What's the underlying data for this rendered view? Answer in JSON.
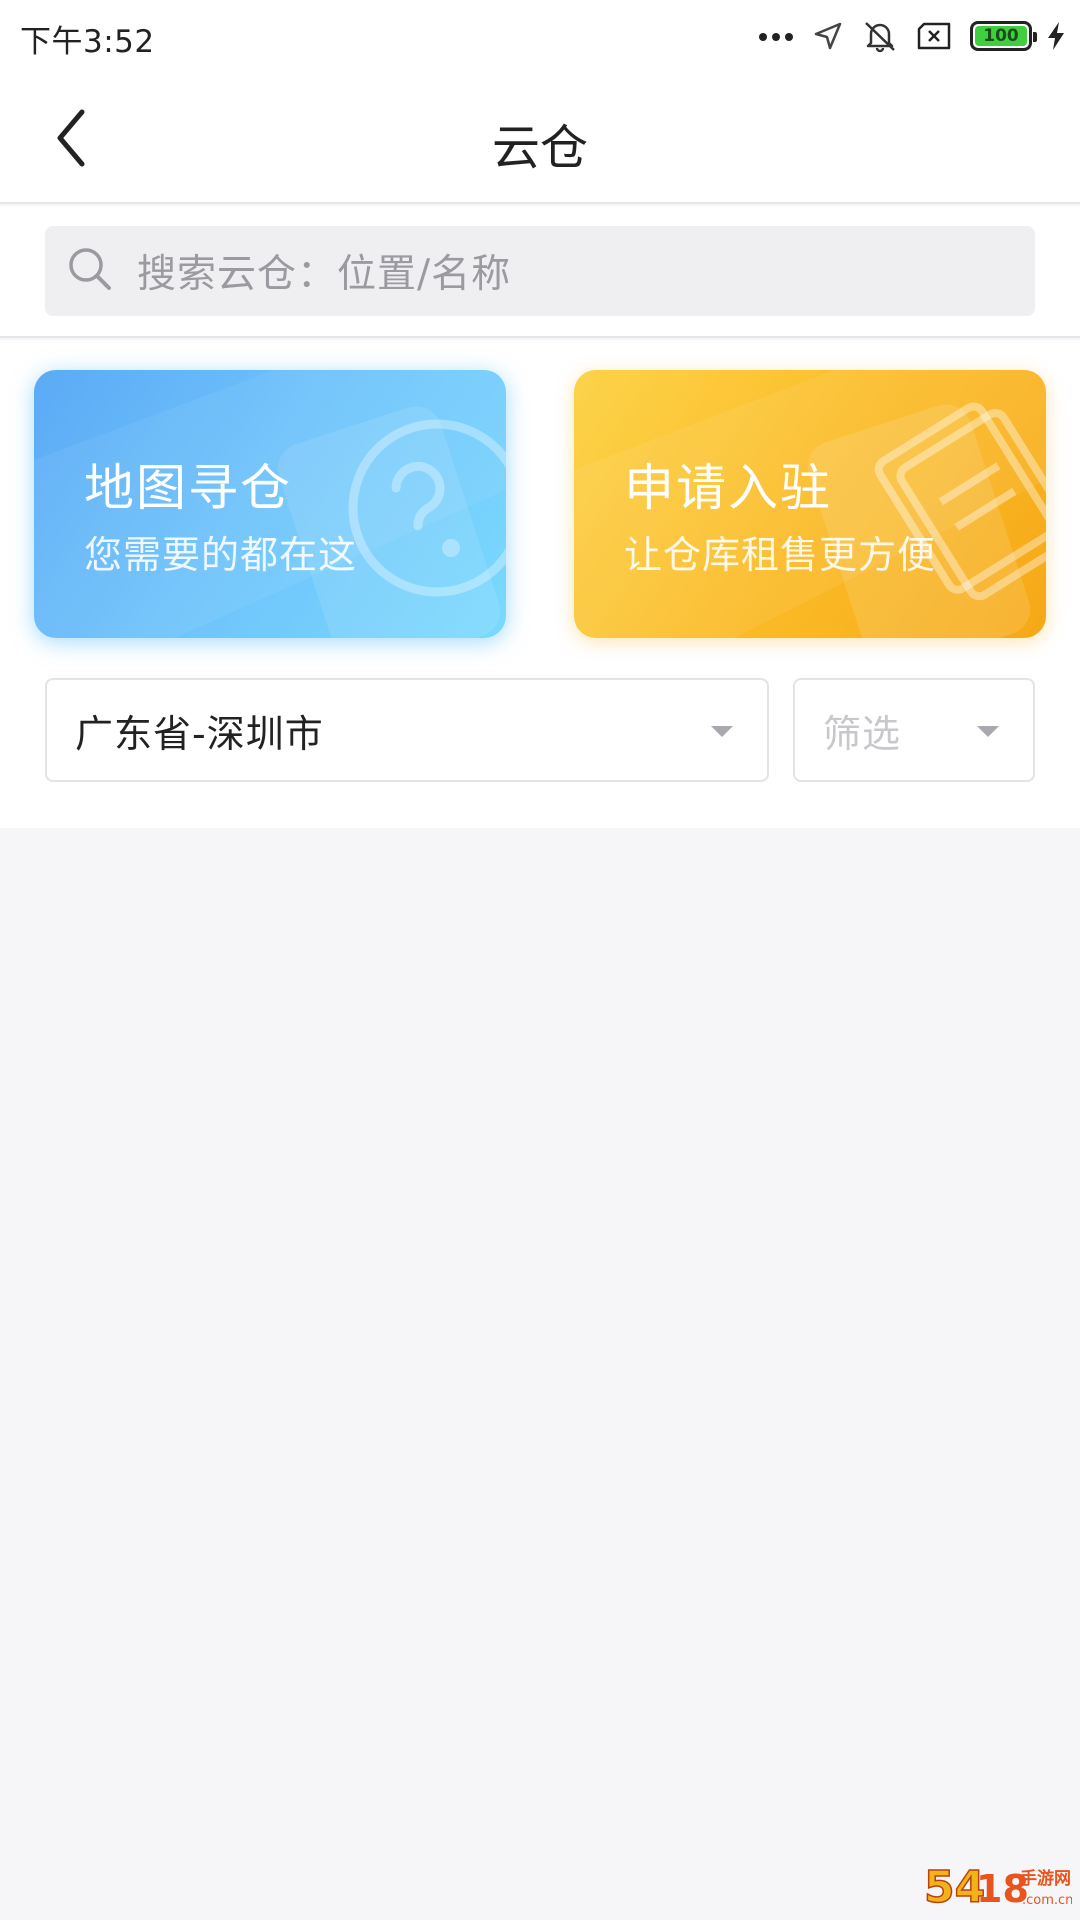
{
  "status_bar": {
    "time": "下午3:52",
    "battery_level": "100",
    "icons": [
      "more-dots-icon",
      "location-arrow-icon",
      "mute-bell-icon",
      "sim-x-icon",
      "battery-icon",
      "charging-bolt-icon"
    ]
  },
  "header": {
    "title": "云仓",
    "back_icon": "chevron-left-icon"
  },
  "search": {
    "placeholder": "搜索云仓：位置/名称",
    "icon": "search-icon"
  },
  "cards": [
    {
      "title": "地图寻仓",
      "subtitle": "您需要的都在这",
      "gradient": [
        "#5aaaf5",
        "#7ad9fd"
      ],
      "icon": "question-circle-icon"
    },
    {
      "title": "申请入驻",
      "subtitle": "让仓库租售更方便",
      "gradient": [
        "#fcd34a",
        "#f6a817"
      ],
      "icon": "document-stack-icon"
    }
  ],
  "filters": {
    "region_value": "广东省-深圳市",
    "filter_placeholder": "筛选"
  },
  "watermark": {
    "text": "5418手游网 .com.cn"
  },
  "colors": {
    "page_background": "#f6f6f9",
    "search_background": "#efeff2",
    "blue_card": "#6ec2fb",
    "yellow_card": "#fbbc28"
  }
}
